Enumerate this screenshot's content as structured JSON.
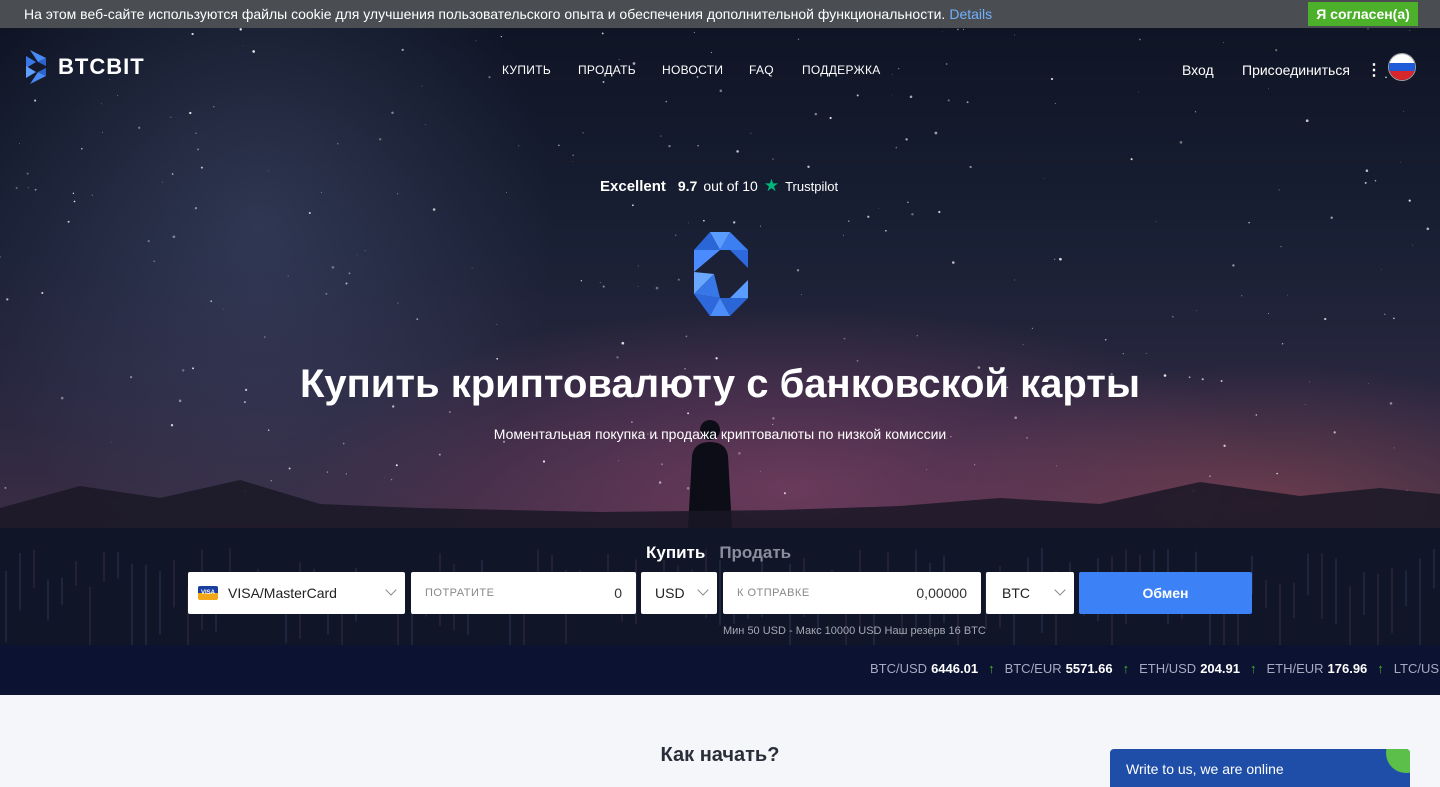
{
  "cookie": {
    "text": "На этом веб-сайте используются файлы cookie для улучшения пользовательского опыта и обеспечения дополнительной функциональности.",
    "details_link": "Details",
    "accept_label": "Я согласен(а)"
  },
  "header": {
    "logo_text": "BTCBIT",
    "nav": [
      "КУПИТЬ",
      "ПРОДАТЬ",
      "НОВОСТИ",
      "FAQ",
      "ПОДДЕРЖКА"
    ],
    "login": "Вход",
    "join": "Присоединиться",
    "more": "⋮"
  },
  "trustpilot": {
    "rating_word": "Excellent",
    "score": "9.7",
    "out_of": "out of 10",
    "brand": "Trustpilot"
  },
  "hero": {
    "title": "Купить криптовалюту с банковской карты",
    "subtitle": "Моментальная покупка и продажа криптовалюты по низкой комиссии"
  },
  "exchange": {
    "tab_buy": "Купить",
    "tab_sell": "Продать",
    "payment_method": "VISA/MasterCard",
    "spend_placeholder": "ПОТРАТИТЕ",
    "spend_value": "0",
    "spend_currency": "USD",
    "receive_placeholder": "К ОТПРАВКЕ",
    "receive_value": "0,00000",
    "receive_currency": "BTC",
    "submit_label": "Обмен",
    "limits": "Мин 50 USD - Макс 10000 USD Наш резерв 16 BTC"
  },
  "ticker": [
    {
      "pair": "BTC/USD",
      "value": "6446.01"
    },
    {
      "pair": "BTC/EUR",
      "value": "5571.66"
    },
    {
      "pair": "ETH/USD",
      "value": "204.91"
    },
    {
      "pair": "ETH/EUR",
      "value": "176.96"
    },
    {
      "pair": "LTC/USD",
      "value": ""
    }
  ],
  "how": {
    "title": "Как начать?"
  },
  "chat": {
    "label": "Write to us, we are online"
  },
  "colors": {
    "accent": "#3c82f6",
    "cookie_accept": "#4cb02a",
    "trustpilot_star": "#00b67a"
  },
  "icons": {
    "logo": "btcbit-logo-icon",
    "flag": "russia-flag-icon",
    "star": "star-icon",
    "arrow": "arrow-up-icon"
  }
}
